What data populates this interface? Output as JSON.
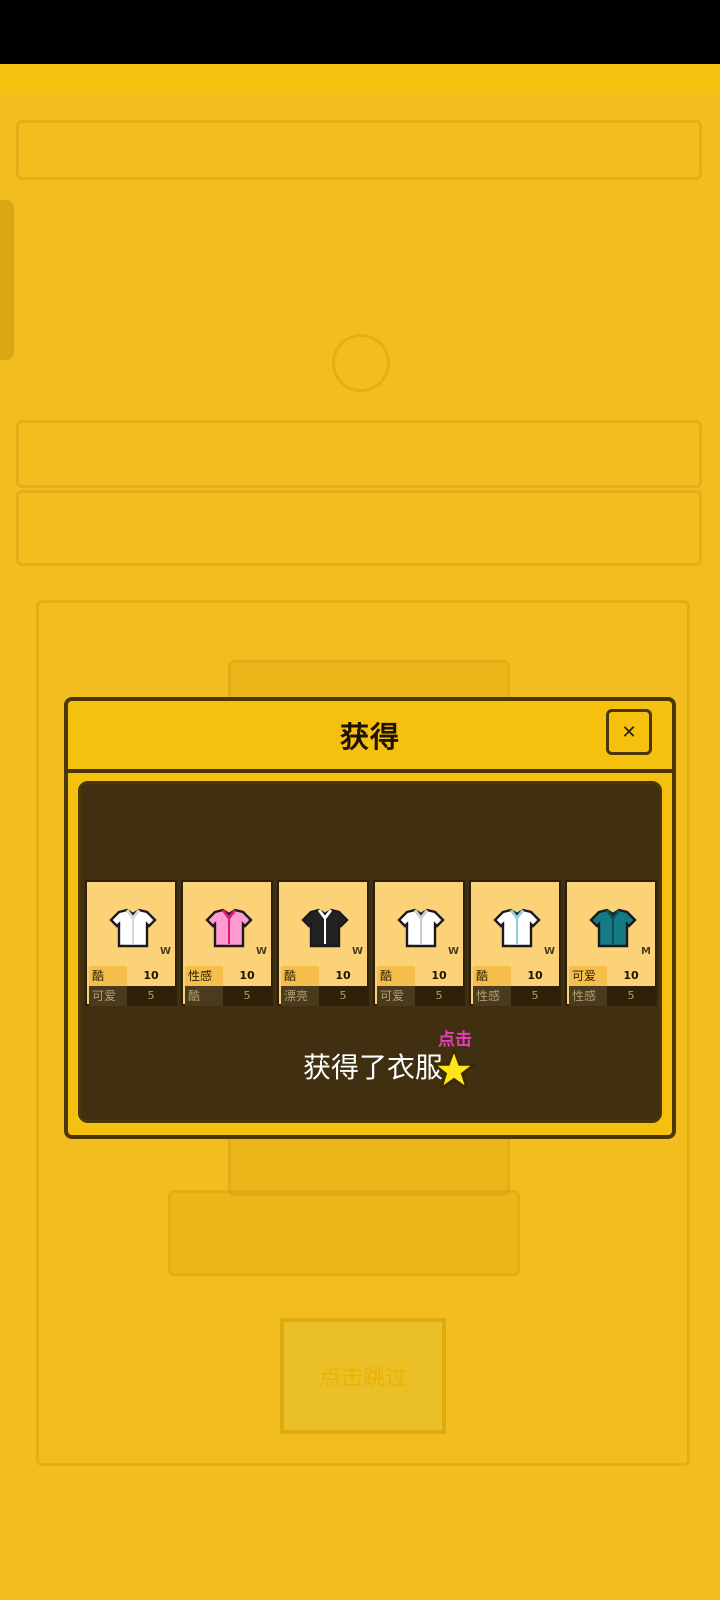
{
  "dialog": {
    "title": "获得",
    "close_icon": "close-icon",
    "message": "获得了衣服",
    "tap_hint": "点击"
  },
  "items": [
    {
      "color": "#ffffff",
      "accent": "#d8d8d8",
      "letter": "W",
      "stat1_label": "酷",
      "stat1_value": "10",
      "stat2_label": "可爱",
      "stat2_value": "5"
    },
    {
      "color": "#ff9bd0",
      "accent": "#e0196e",
      "letter": "W",
      "stat1_label": "性感",
      "stat1_value": "10",
      "stat2_label": "酷",
      "stat2_value": "5"
    },
    {
      "color": "#222222",
      "accent": "#ffffff",
      "letter": "W",
      "stat1_label": "酷",
      "stat1_value": "10",
      "stat2_label": "漂亮",
      "stat2_value": "5"
    },
    {
      "color": "#ffffff",
      "accent": "#cccccc",
      "letter": "W",
      "stat1_label": "酷",
      "stat1_value": "10",
      "stat2_label": "可爱",
      "stat2_value": "5"
    },
    {
      "color": "#ffffff",
      "accent": "#8fd0e0",
      "letter": "W",
      "stat1_label": "酷",
      "stat1_value": "10",
      "stat2_label": "性感",
      "stat2_value": "5"
    },
    {
      "color": "#137a86",
      "accent": "#0b4f58",
      "letter": "M",
      "stat1_label": "可爱",
      "stat1_value": "10",
      "stat2_label": "性感",
      "stat2_value": "5"
    }
  ],
  "background": {
    "button_label": "点击跳过"
  },
  "colors": {
    "dialog_bg": "#f6c10e",
    "dialog_border": "#4a3608",
    "panel_bg": "#403011",
    "card_bg": "#fbd277",
    "tap_hint": "#e23fb8",
    "star": "#ffe41a"
  }
}
